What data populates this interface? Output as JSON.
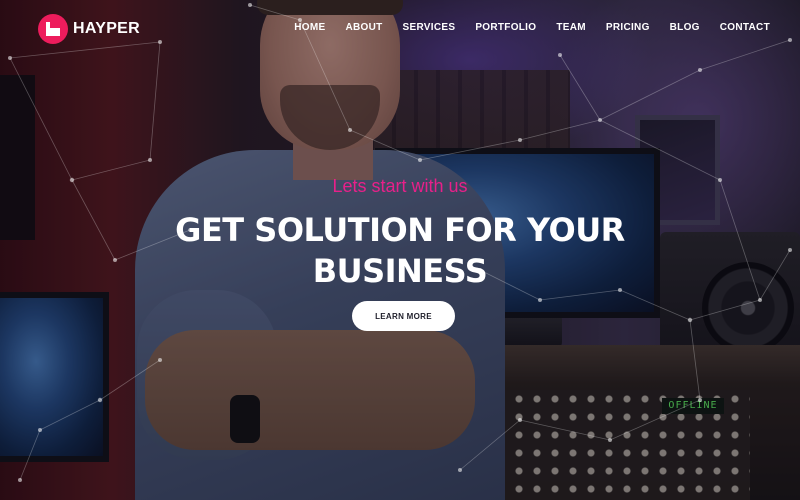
{
  "brand": {
    "name": "HAYPER",
    "accent_color": "#ed1c5c",
    "logo_icon": "square-in-circle-logo-icon"
  },
  "nav": {
    "items": [
      {
        "label": "HOME"
      },
      {
        "label": "ABOUT"
      },
      {
        "label": "SERVICES"
      },
      {
        "label": "PORTFOLIO"
      },
      {
        "label": "TEAM"
      },
      {
        "label": "PRICING"
      },
      {
        "label": "BLOG"
      },
      {
        "label": "CONTACT"
      }
    ]
  },
  "hero": {
    "tagline": "Lets start with us",
    "tagline_color": "#e8208a",
    "headline": "GET SOLUTION FOR YOUR BUSINESS",
    "cta_label": "LEARN MORE",
    "background_image": "man-in-music-studio-photo",
    "mixer_display": "OFFLINE"
  }
}
